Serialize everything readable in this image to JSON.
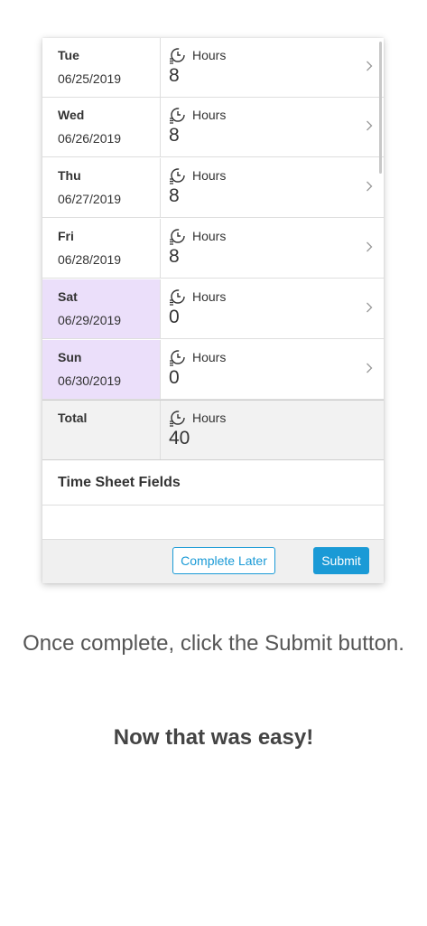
{
  "days": [
    {
      "day": "Tue",
      "date": "06/25/2019",
      "hours_label": "Hours",
      "hours": "8",
      "weekend": false
    },
    {
      "day": "Wed",
      "date": "06/26/2019",
      "hours_label": "Hours",
      "hours": "8",
      "weekend": false
    },
    {
      "day": "Thu",
      "date": "06/27/2019",
      "hours_label": "Hours",
      "hours": "8",
      "weekend": false
    },
    {
      "day": "Fri",
      "date": "06/28/2019",
      "hours_label": "Hours",
      "hours": "8",
      "weekend": false
    },
    {
      "day": "Sat",
      "date": "06/29/2019",
      "hours_label": "Hours",
      "hours": "0",
      "weekend": true
    },
    {
      "day": "Sun",
      "date": "06/30/2019",
      "hours_label": "Hours",
      "hours": "0",
      "weekend": true
    }
  ],
  "total": {
    "label": "Total",
    "hours_label": "Hours",
    "hours": "40"
  },
  "time_sheet_fields": {
    "title": "Time Sheet Fields"
  },
  "footer": {
    "complete_later_label": "Complete Later",
    "submit_label": "Submit"
  },
  "caption": "Once complete, click the Submit button.",
  "tagline": "Now that was easy!",
  "colors": {
    "accent": "#1a9ad6",
    "weekend": "#ebdffa",
    "total_bg": "#f2f2f2"
  },
  "icons": {
    "hours": "clock-list-icon",
    "row_action": "chevron-right-icon"
  }
}
